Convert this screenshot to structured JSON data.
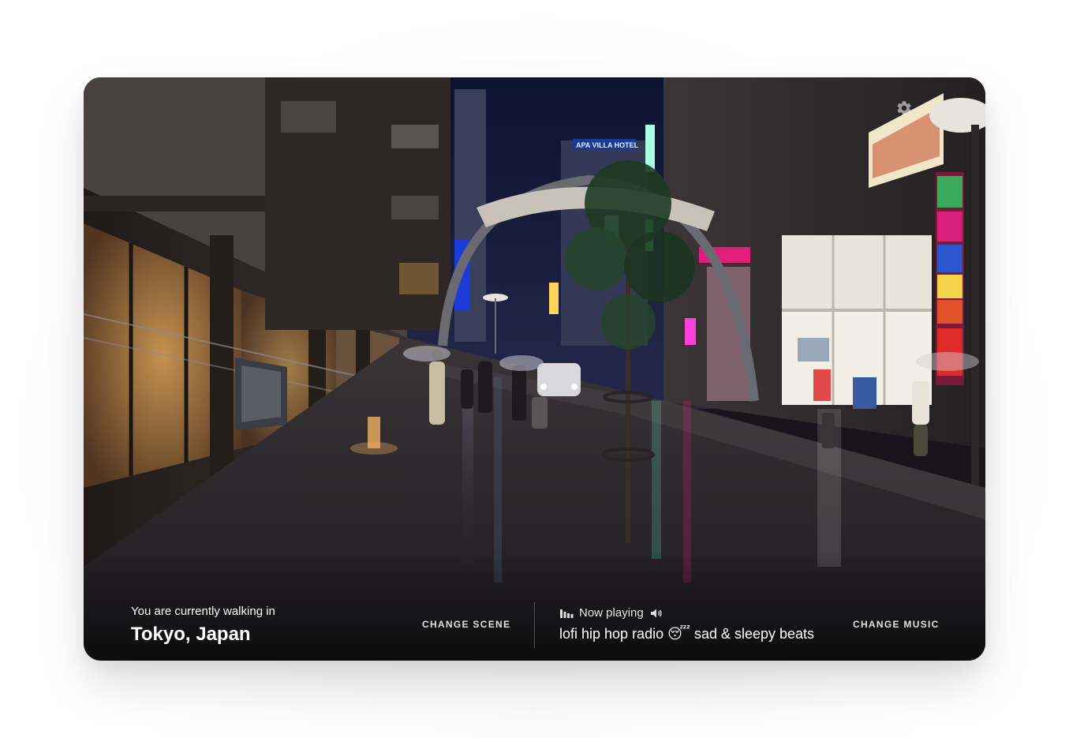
{
  "location": {
    "label": "You are currently walking in",
    "city": "Tokyo, Japan",
    "change_scene_label": "CHANGE SCENE"
  },
  "player": {
    "status": "Now playing",
    "track": "lofi hip hop radio 😴 sad & sleepy beats",
    "change_music_label": "CHANGE MUSIC"
  },
  "icons": {
    "settings": "gear-icon",
    "equalizer": "equalizer-icon",
    "volume": "volume-icon"
  },
  "scene_signs": {
    "hotel_sign": "APA VILLA HOTEL"
  },
  "colors": {
    "text": "#ffffff",
    "night_sky": "#0f1530",
    "street": "#2a2628"
  }
}
